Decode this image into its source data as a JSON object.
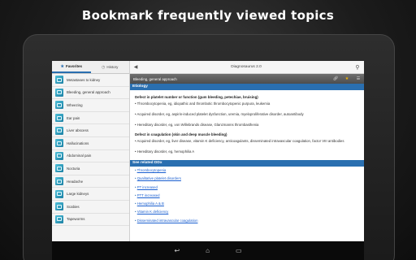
{
  "headline": "Bookmark frequently viewed topics",
  "left_pane": {
    "tabs": [
      {
        "label": "Favorites",
        "icon": "star-icon"
      },
      {
        "label": "History",
        "icon": "clock-icon"
      }
    ],
    "items": [
      "Metastases to kidney",
      "Bleeding, general approach",
      "Wheezing",
      "Ear pain",
      "Liver abscess",
      "Hallucinations",
      "Abdominal pain",
      "Nocturia",
      "Headache",
      "Large kidneys",
      "Scabies",
      "Tapeworms"
    ]
  },
  "topbar": {
    "title": "Diagnosaurus 2.0"
  },
  "subbar": {
    "title": "Bleeding, general approach"
  },
  "content": {
    "section_title": "Etiology",
    "groups": [
      {
        "title": "Defect in platelet number or function (gum bleeding, petechiae, bruising)",
        "items": [
          "• Thrombocytopenia, eg, idiopathic and thrombotic thrombocytopenic purpura, leukemia",
          "• Acquired disorder, eg, aspirin-induced platelet dysfunction, uremia, myeloproliferative disorder, autoantibody",
          "• Hereditary disorder, eg, von Willebrands disease, Glanzmanns thrombasthenia"
        ]
      },
      {
        "title": "Defect in coagulation (skin and deep muscle bleeding)",
        "items": [
          "• Acquired disorder, eg, liver disease, vitamin K deficiency, anticoagulants, disseminated intravascular coagulation, factor VIII antibodies",
          "• Hereditary disorder, eg, hemophilia A"
        ]
      }
    ],
    "related_title": "See related DDx",
    "related": [
      "Thrombocytopenia",
      "Qualitative platelet disorders",
      "PT increased",
      "PTT increased",
      "Hemophilia A & B",
      "Vitamin K deficiency",
      "Disseminated intravascular coagulation"
    ]
  }
}
